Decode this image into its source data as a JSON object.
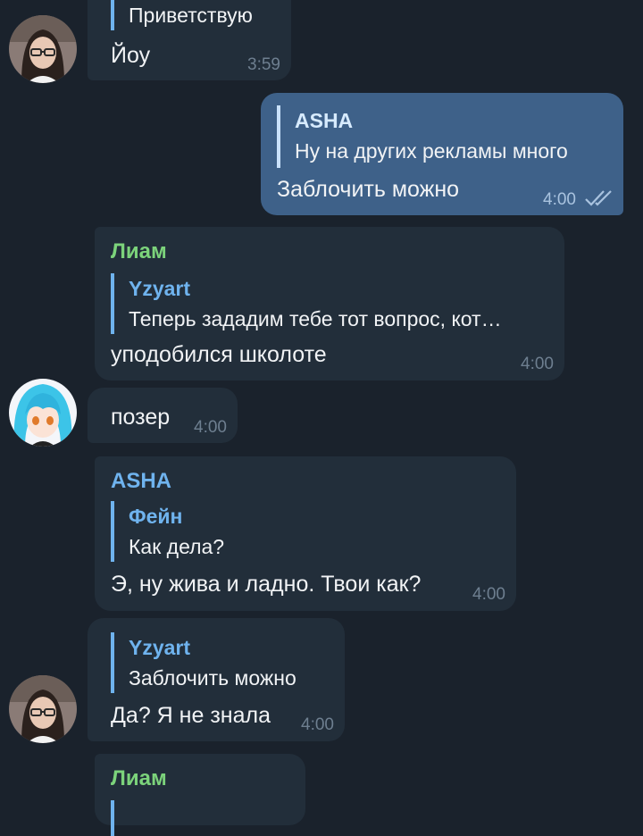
{
  "colors": {
    "background": "#1a222c",
    "incoming_bubble": "#222e3a",
    "outgoing_bubble": "#3e6189",
    "name_green": "#7cd37b",
    "name_blue": "#6fb3ee",
    "timestamp": "#6e7f90"
  },
  "messages": [
    {
      "reply_text": "Приветствую",
      "text": "Йоу",
      "time": "3:59",
      "avatar": "avatar-glasses-girl"
    },
    {
      "direction": "outgoing",
      "reply_name": "ASHA",
      "reply_text": "Ну на других рекламы много",
      "text": "Заблочить можно",
      "time": "4:00",
      "status_icon": "double-check-icon"
    },
    {
      "sender": "Лиам",
      "reply_name": "Yzyart",
      "reply_text": "Теперь зададим тебе тот вопрос, кот…",
      "text": "уподобился школоте",
      "time": "4:00"
    },
    {
      "text": "позер",
      "time": "4:00",
      "avatar": "avatar-blue-hair"
    },
    {
      "sender": "ASHA",
      "reply_name": "Фейн",
      "reply_text": "Как дела?",
      "text": "Э, ну жива и ладно. Твои как?",
      "time": "4:00"
    },
    {
      "reply_name": "Yzyart",
      "reply_text": "Заблочить можно",
      "text": "Да? Я не знала",
      "time": "4:00",
      "avatar": "avatar-glasses-girl"
    },
    {
      "sender": "Лиам"
    }
  ]
}
